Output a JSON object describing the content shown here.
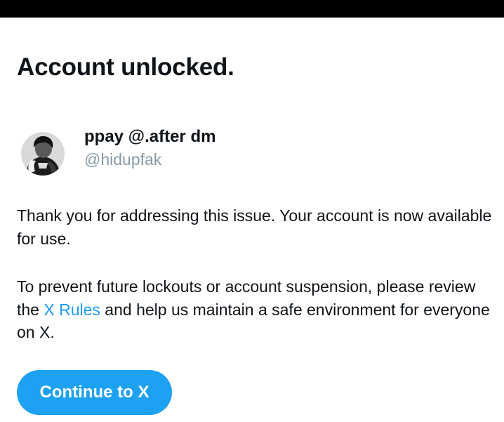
{
  "title": "Account unlocked.",
  "profile": {
    "display_name": "ppay @.after dm",
    "handle": "@hidupfak"
  },
  "message": {
    "paragraph1": "Thank you for addressing this issue. Your account is now available for use.",
    "paragraph2_before": "To prevent future lockouts or account suspension, please review the ",
    "paragraph2_link": "X Rules",
    "paragraph2_after": " and help us maintain a safe environment for everyone on X."
  },
  "button": {
    "label": "Continue to X"
  },
  "colors": {
    "accent": "#1da1f2",
    "link": "#1d9bf0",
    "text": "#0f1419",
    "secondary_text": "#8899a6",
    "status_bar": "#000000"
  }
}
